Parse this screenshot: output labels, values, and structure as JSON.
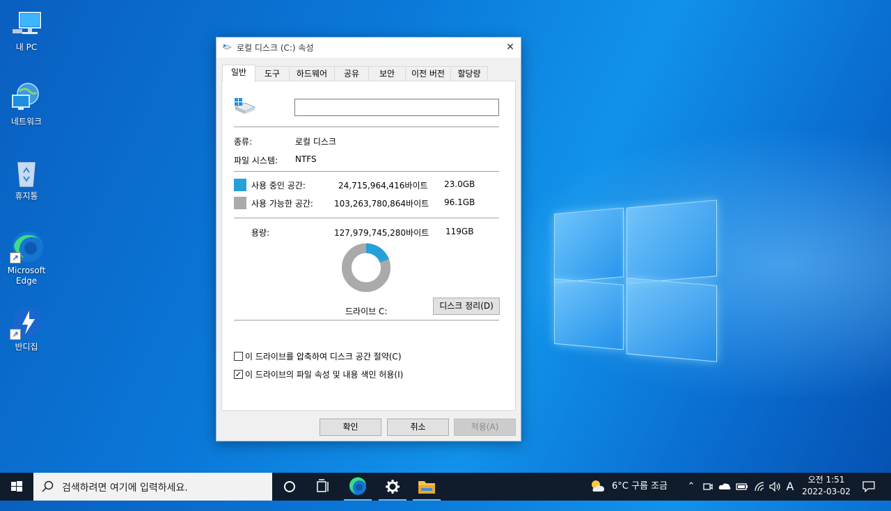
{
  "desktop": {
    "icons": [
      {
        "label": "내 PC"
      },
      {
        "label": "네트워크"
      },
      {
        "label": "휴지통"
      },
      {
        "label": "Microsoft Edge"
      },
      {
        "label": "반디집"
      }
    ]
  },
  "dialog": {
    "title": "로컬 디스크 (C:) 속성",
    "close_glyph": "✕",
    "tabs": [
      "일반",
      "도구",
      "하드웨어",
      "공유",
      "보안",
      "이전 버전",
      "할당량"
    ],
    "active_tab": "일반",
    "name_value": "",
    "type_label": "종류:",
    "type_value": "로컬 디스크",
    "fs_label": "파일 시스템:",
    "fs_value": "NTFS",
    "used": {
      "label": "사용 중인 공간:",
      "bytes": "24,715,964,416바이트",
      "size": "23.0GB",
      "color": "#26a0da"
    },
    "free": {
      "label": "사용 가능한 공간:",
      "bytes": "103,263,780,864바이트",
      "size": "96.1GB",
      "color": "#aaaaaa"
    },
    "capacity": {
      "label": "용량:",
      "bytes": "127,979,745,280바이트",
      "size": "119GB"
    },
    "used_fraction": 0.193,
    "drive_label": "드라이브 C:",
    "cleanup_button": "디스크 정리(D)",
    "compress_checkbox": {
      "label": "이 드라이브를 압축하여 디스크 공간 절약(C)",
      "checked": false
    },
    "index_checkbox": {
      "label": "이 드라이브의 파일 속성 및 내용 색인 허용(I)",
      "checked": true
    },
    "ok_button": "확인",
    "cancel_button": "취소",
    "apply_button": "적용(A)"
  },
  "taskbar": {
    "search_placeholder": "검색하려면 여기에 입력하세요.",
    "weather": "6°C  구름 조금",
    "ime": "A",
    "time": "오전 1:51",
    "date": "2022-03-02"
  }
}
